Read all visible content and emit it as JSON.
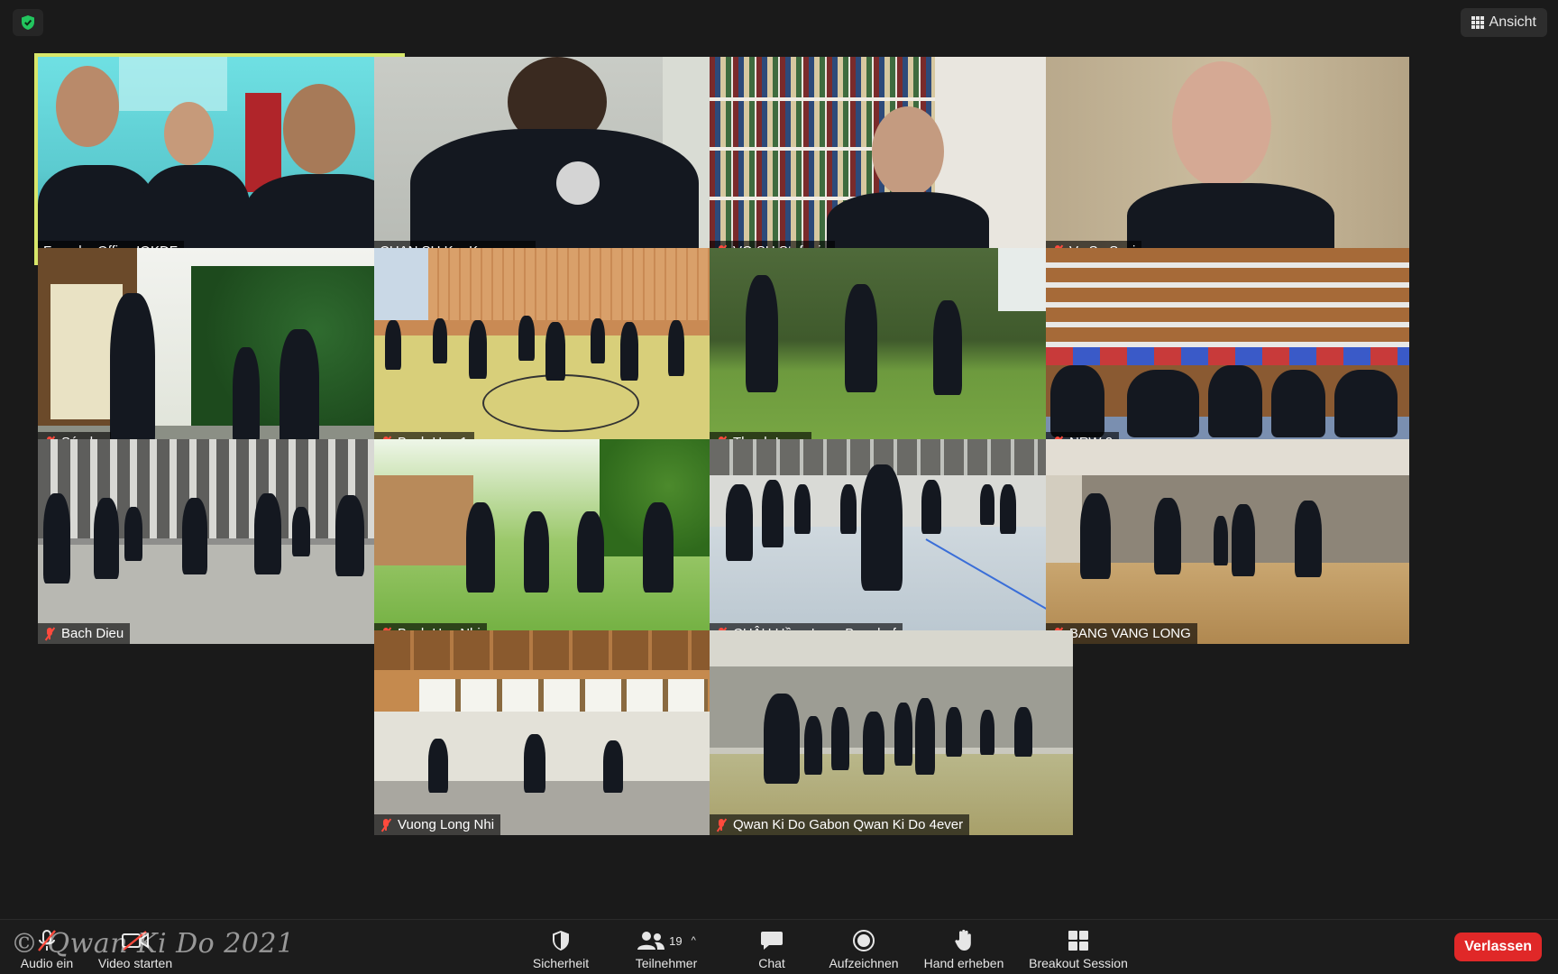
{
  "top": {
    "view_label": "Ansicht"
  },
  "tiles": [
    {
      "name": "Founder Office IQKDF",
      "muted": false,
      "active": true
    },
    {
      "name": "CHAN SU Kra Kossonou",
      "muted": false,
      "active": false
    },
    {
      "name": "VO SU Stefanie",
      "muted": true,
      "active": false
    },
    {
      "name": "Vo Su Susi",
      "muted": true,
      "active": false
    },
    {
      "name": "Sándor",
      "muted": true,
      "active": false
    },
    {
      "name": "Bach Hac 1",
      "muted": true,
      "active": false
    },
    {
      "name": "Thanh Long",
      "muted": true,
      "active": false
    },
    {
      "name": "NRW 2",
      "muted": true,
      "active": false
    },
    {
      "name": "Bach Dieu",
      "muted": true,
      "active": false
    },
    {
      "name": "Bach Hac Nhi",
      "muted": true,
      "active": false
    },
    {
      "name": "CHÂU Hồng Long Borsdorf",
      "muted": true,
      "active": false
    },
    {
      "name": "BANG VANG LONG",
      "muted": true,
      "active": false
    },
    {
      "name": "Vuong Long Nhi",
      "muted": true,
      "active": false
    },
    {
      "name": "Qwan Ki Do Gabon Qwan Ki Do 4ever",
      "muted": true,
      "active": false
    }
  ],
  "toolbar": {
    "audio_label": "Audio ein",
    "video_label": "Video starten",
    "security_label": "Sicherheit",
    "participants_label": "Teilnehmer",
    "participants_count": "19",
    "chat_label": "Chat",
    "record_label": "Aufzeichnen",
    "raise_hand_label": "Hand erheben",
    "breakout_label": "Breakout Session",
    "leave_label": "Verlassen"
  },
  "watermark": "© Qwan Ki Do 2021",
  "colors": {
    "background": "#1a1a1a",
    "active_speaker_border": "#d8e76a",
    "leave_button": "#e02828",
    "mute_icon": "#ff4a3d",
    "security_shield": "#22c55e"
  }
}
